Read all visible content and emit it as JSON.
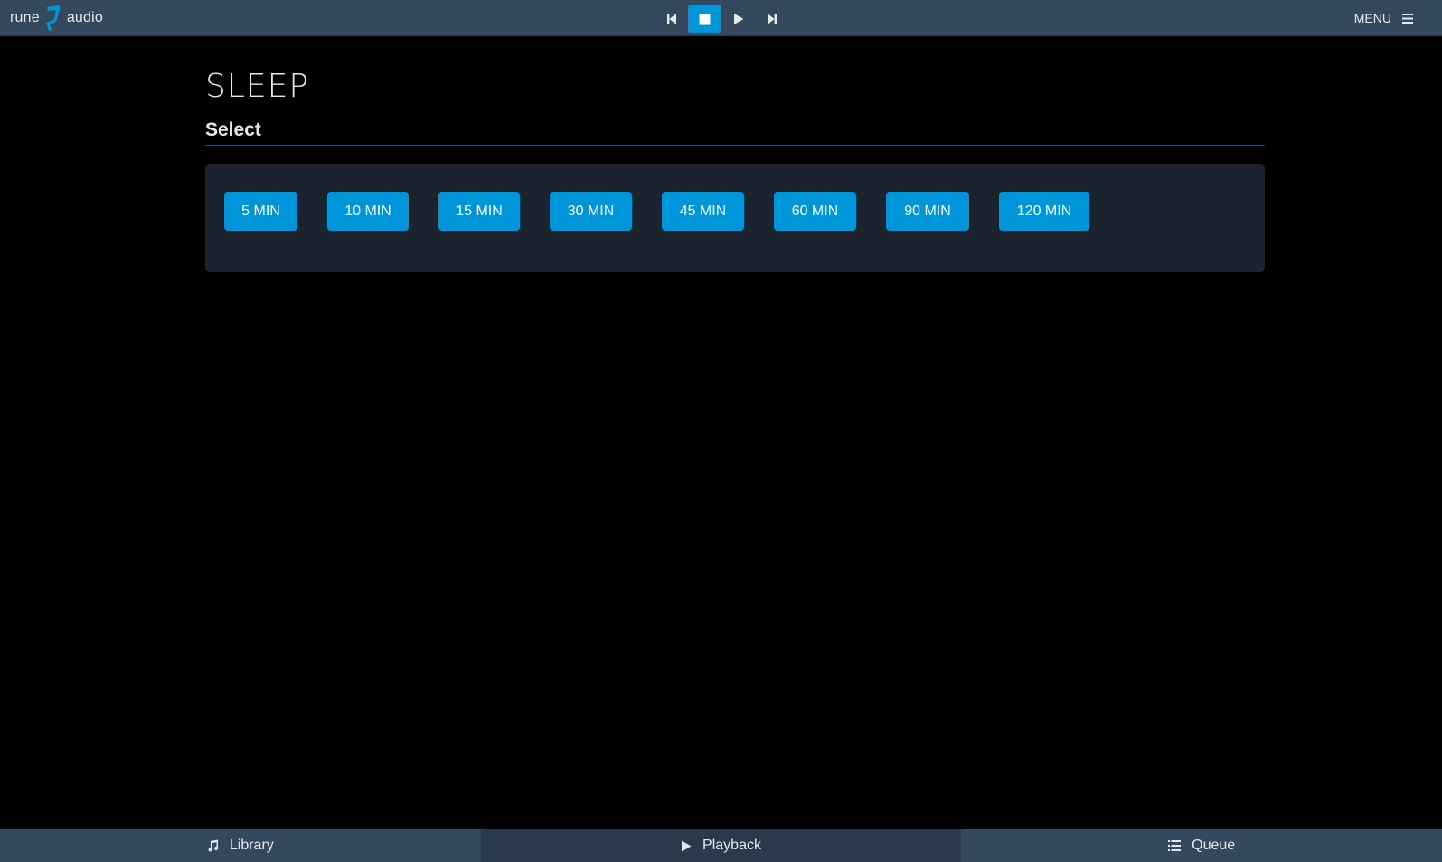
{
  "app": {
    "logo_left": "rune",
    "logo_right": "audio"
  },
  "topbar": {
    "transport": [
      {
        "name": "previous",
        "icon": "skip-previous-icon",
        "active": false
      },
      {
        "name": "stop",
        "icon": "stop-icon",
        "active": true
      },
      {
        "name": "play",
        "icon": "play-icon",
        "active": false
      },
      {
        "name": "next",
        "icon": "skip-next-icon",
        "active": false
      }
    ],
    "menu_label": "MENU",
    "menu_icon": "hamburger-icon"
  },
  "page": {
    "title": "SLEEP",
    "section_title": "Select"
  },
  "sleep_options": [
    {
      "label": "5 MIN"
    },
    {
      "label": "10 MIN"
    },
    {
      "label": "15 MIN"
    },
    {
      "label": "30 MIN"
    },
    {
      "label": "45 MIN"
    },
    {
      "label": "60 MIN"
    },
    {
      "label": "90 MIN"
    },
    {
      "label": "120 MIN"
    }
  ],
  "bottom_tabs": [
    {
      "label": "Library",
      "icon": "music-note-icon",
      "active": false
    },
    {
      "label": "Playback",
      "icon": "play-icon",
      "active": true
    },
    {
      "label": "Queue",
      "icon": "list-icon",
      "active": false
    }
  ],
  "colors": {
    "accent": "#0095d8",
    "topbar": "#34495e",
    "panel": "#1b242e",
    "background": "#000000"
  }
}
